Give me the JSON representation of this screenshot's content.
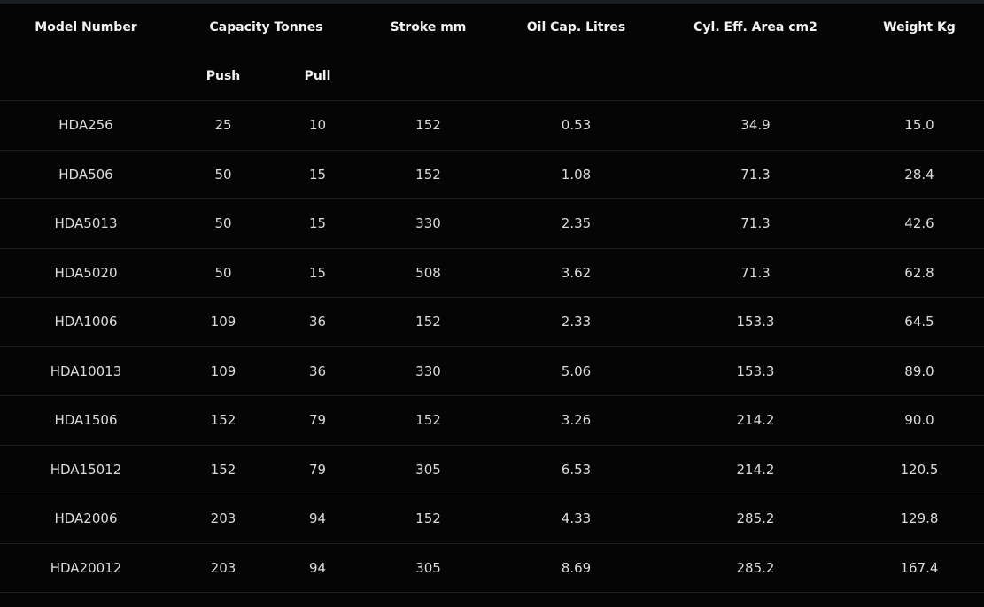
{
  "table": {
    "headers": {
      "model": "Model Number",
      "capacity": "Capacity Tonnes",
      "stroke": "Stroke mm",
      "oil": "Oil Cap. Litres",
      "area": "Cyl. Eff. Area cm2",
      "weight": "Weight Kg",
      "push": "Push",
      "pull": "Pull"
    },
    "rows": [
      {
        "model": "HDA256",
        "push": "25",
        "pull": "10",
        "stroke": "152",
        "oil": "0.53",
        "area": "34.9",
        "weight": "15.0"
      },
      {
        "model": "HDA506",
        "push": "50",
        "pull": "15",
        "stroke": "152",
        "oil": "1.08",
        "area": "71.3",
        "weight": "28.4"
      },
      {
        "model": "HDA5013",
        "push": "50",
        "pull": "15",
        "stroke": "330",
        "oil": "2.35",
        "area": "71.3",
        "weight": "42.6"
      },
      {
        "model": "HDA5020",
        "push": "50",
        "pull": "15",
        "stroke": "508",
        "oil": "3.62",
        "area": "71.3",
        "weight": "62.8"
      },
      {
        "model": "HDA1006",
        "push": "109",
        "pull": "36",
        "stroke": "152",
        "oil": "2.33",
        "area": "153.3",
        "weight": "64.5"
      },
      {
        "model": "HDA10013",
        "push": "109",
        "pull": "36",
        "stroke": "330",
        "oil": "5.06",
        "area": "153.3",
        "weight": "89.0"
      },
      {
        "model": "HDA1506",
        "push": "152",
        "pull": "79",
        "stroke": "152",
        "oil": "3.26",
        "area": "214.2",
        "weight": "90.0"
      },
      {
        "model": "HDA15012",
        "push": "152",
        "pull": "79",
        "stroke": "305",
        "oil": "6.53",
        "area": "214.2",
        "weight": "120.5"
      },
      {
        "model": "HDA2006",
        "push": "203",
        "pull": "94",
        "stroke": "152",
        "oil": "4.33",
        "area": "285.2",
        "weight": "129.8"
      },
      {
        "model": "HDA20012",
        "push": "203",
        "pull": "94",
        "stroke": "305",
        "oil": "8.69",
        "area": "285.2",
        "weight": "167.4"
      }
    ]
  }
}
